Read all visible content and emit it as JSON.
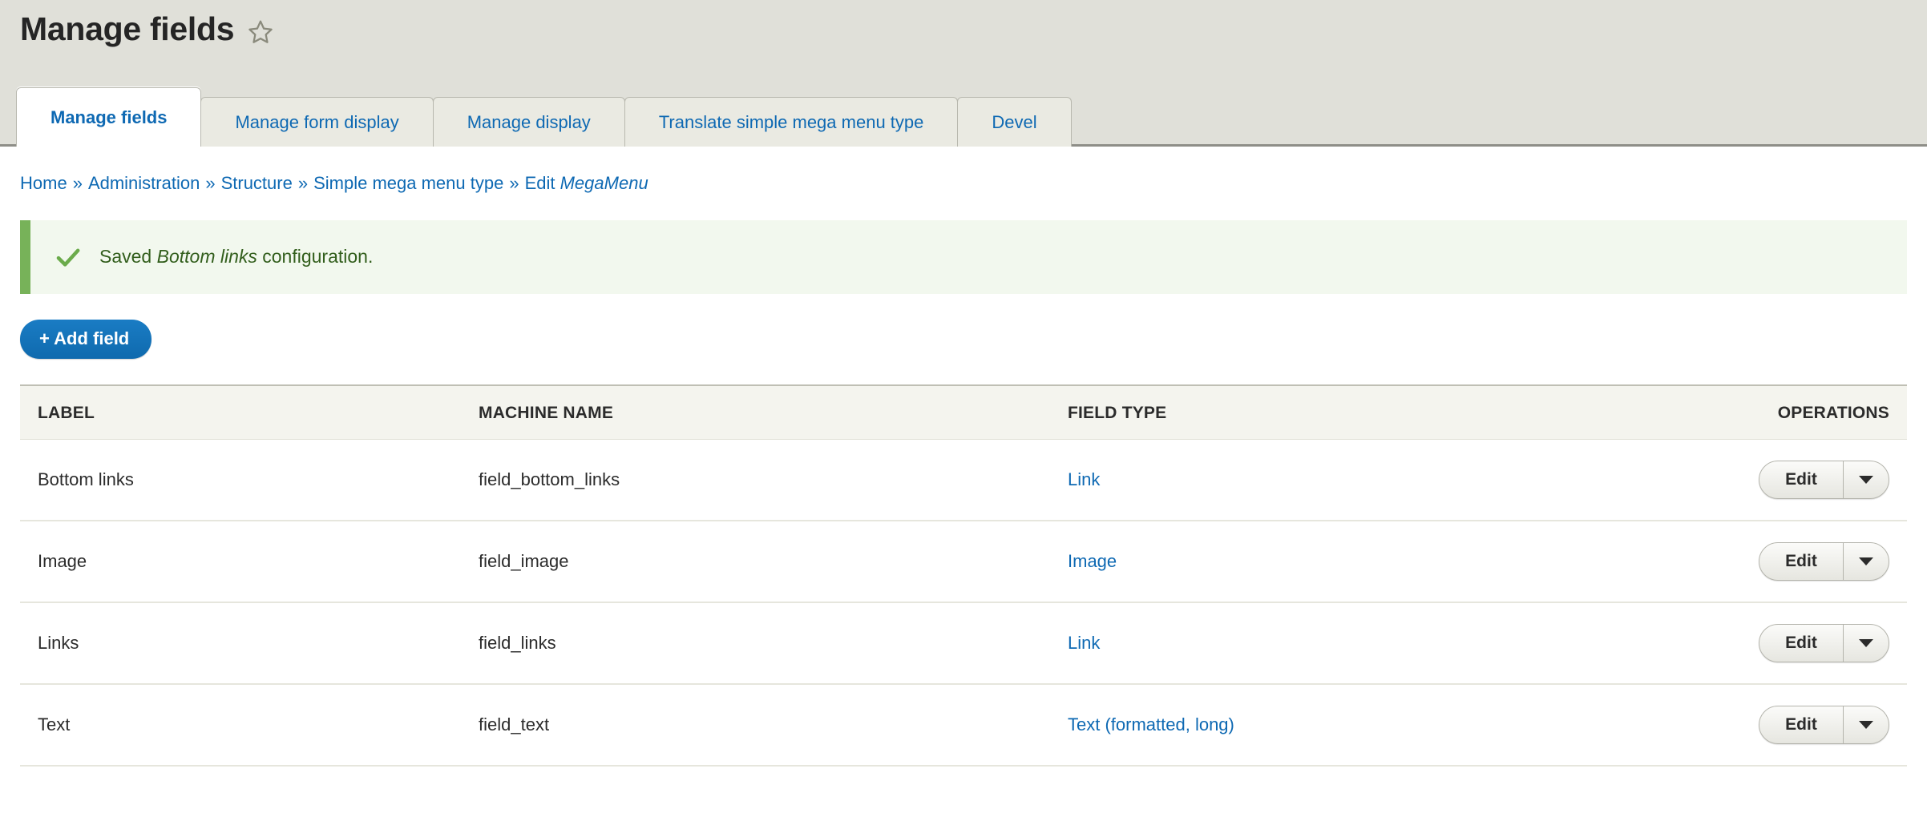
{
  "header": {
    "title": "Manage fields",
    "bookmark_icon": "star-outline-icon"
  },
  "tabs": [
    {
      "label": "Manage fields",
      "active": true
    },
    {
      "label": "Manage form display",
      "active": false
    },
    {
      "label": "Manage display",
      "active": false
    },
    {
      "label": "Translate simple mega menu type",
      "active": false
    },
    {
      "label": "Devel",
      "active": false
    }
  ],
  "breadcrumb": {
    "separator": "»",
    "items": [
      {
        "label": "Home",
        "link": true
      },
      {
        "label": "Administration",
        "link": true
      },
      {
        "label": "Structure",
        "link": true
      },
      {
        "label": "Simple mega menu type",
        "link": true
      }
    ],
    "current_prefix": "Edit ",
    "current_emphasis": "MegaMenu"
  },
  "status_message": {
    "icon": "check-icon",
    "prefix": "Saved ",
    "emphasis": "Bottom links",
    "suffix": " configuration."
  },
  "actions": {
    "add_field_label": "+ Add field"
  },
  "table": {
    "columns": {
      "label": "LABEL",
      "machine_name": "MACHINE NAME",
      "field_type": "FIELD TYPE",
      "operations": "OPERATIONS"
    },
    "rows": [
      {
        "label": "Bottom links",
        "machine_name": "field_bottom_links",
        "field_type": "Link",
        "operation_label": "Edit",
        "toggle_icon": "chevron-down-icon"
      },
      {
        "label": "Image",
        "machine_name": "field_image",
        "field_type": "Image",
        "operation_label": "Edit",
        "toggle_icon": "chevron-down-icon"
      },
      {
        "label": "Links",
        "machine_name": "field_links",
        "field_type": "Link",
        "operation_label": "Edit",
        "toggle_icon": "chevron-down-icon"
      },
      {
        "label": "Text",
        "machine_name": "field_text",
        "field_type": "Text (formatted, long)",
        "operation_label": "Edit",
        "toggle_icon": "chevron-down-icon"
      }
    ]
  },
  "colors": {
    "link": "#0e69b3",
    "header_band": "#e0e0d9",
    "status_bg": "#f2f8ee",
    "status_border": "#77b259",
    "status_text": "#325e1c",
    "primary_button": "#0f6aae",
    "table_header_bg": "#f4f4ee"
  }
}
